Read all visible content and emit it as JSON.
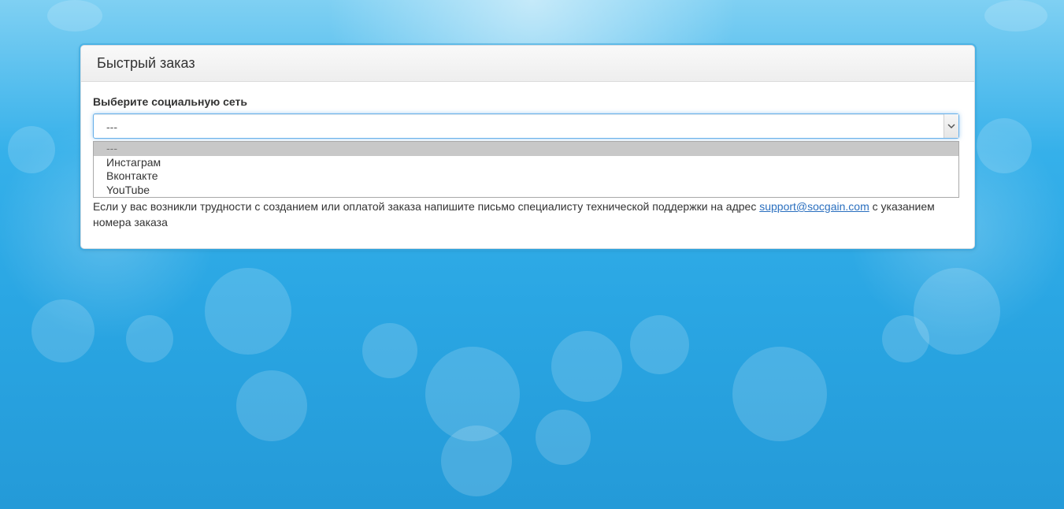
{
  "panel": {
    "title": "Быстрый заказ"
  },
  "form": {
    "social_label": "Выберите социальную сеть",
    "select": {
      "selected_value": "---",
      "options": [
        "---",
        "Инстаграм",
        "Вконтакте",
        "YouTube"
      ]
    }
  },
  "help": {
    "text_before": "Если у вас возникли трудности с созданием или оплатой заказа напишите письмо специалисту технической поддержки на адрес ",
    "email": "support@socgain.com",
    "text_after": " с указанием номера заказа"
  },
  "icons": {
    "dropdown_arrow": "chevron-down-icon"
  },
  "colors": {
    "background_blue": "#2aa6e3",
    "focus_border": "#66afe9",
    "link": "#2a6fbf",
    "highlighted_option": "#c8c8c8"
  }
}
